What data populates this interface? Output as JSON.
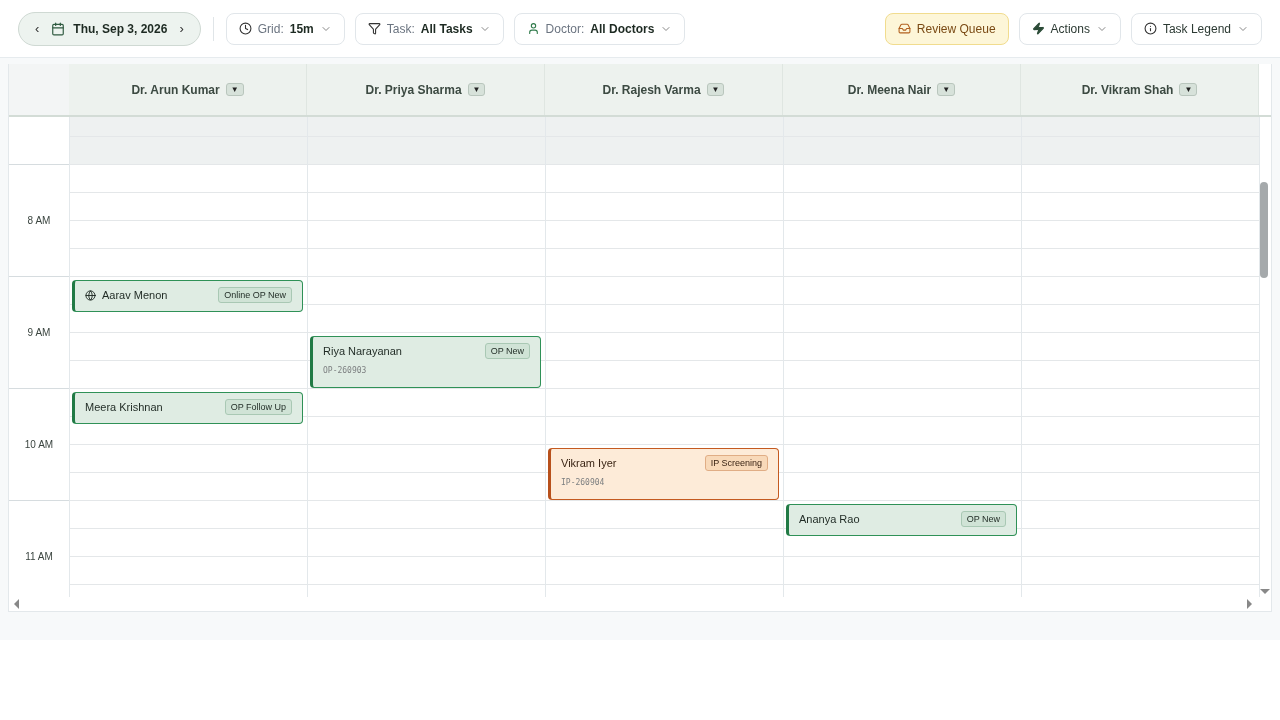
{
  "toolbar": {
    "date_nav": {
      "prev": "‹",
      "date": "Thu, Sep 3, 2026",
      "next": "›"
    },
    "filters": [
      {
        "kind": "grid",
        "label": "Grid:",
        "value": "15m"
      },
      {
        "kind": "task",
        "label": "Task:",
        "value": "All Tasks"
      },
      {
        "kind": "doctor",
        "label": "Doctor:",
        "value": "All Doctors"
      }
    ],
    "review_queue": "Review Queue",
    "actions": "Actions",
    "task_legend": "Task Legend"
  },
  "hours": [
    {
      "off_hours": true
    },
    {
      "label": "8 AM",
      "off_hours": false
    },
    {
      "label": "9 AM",
      "off_hours": false
    },
    {
      "label": "10 AM",
      "off_hours": false
    },
    {
      "label": "11 AM",
      "off_hours": false
    }
  ],
  "doctors": [
    {
      "name": "Dr. Arun Kumar",
      "menu": "▼",
      "slots": [
        {
          "kind": "free"
        },
        {
          "kind": "free"
        },
        {
          "kind": "free"
        },
        {
          "kind": "free"
        },
        {
          "kind": "op",
          "online": true,
          "name": "Aarav Menon",
          "tag": "Online OP New"
        },
        {
          "kind": "free"
        },
        {
          "kind": "free"
        },
        {
          "kind": "free"
        },
        {
          "kind": "op",
          "online": false,
          "name": "Meera Krishnan",
          "tag": "OP Follow Up"
        },
        {
          "kind": "free"
        },
        {
          "kind": "free"
        },
        {
          "kind": "free"
        },
        {
          "kind": "free"
        },
        {
          "kind": "free"
        },
        {
          "kind": "free"
        },
        {
          "kind": "free"
        }
      ]
    },
    {
      "name": "Dr. Priya Sharma",
      "menu": "▼",
      "slots": [
        {
          "kind": "free"
        },
        {
          "kind": "free"
        },
        {
          "kind": "free"
        },
        {
          "kind": "free"
        },
        {
          "kind": "free"
        },
        {
          "kind": "free"
        },
        {
          "kind": "op",
          "online": false,
          "name": "Riya Narayanan",
          "tag": "OP New",
          "mrn": "OP-260903"
        },
        {
          "kind": "cont"
        },
        {
          "kind": "free"
        },
        {
          "kind": "free"
        },
        {
          "kind": "free"
        },
        {
          "kind": "free"
        },
        {
          "kind": "free"
        },
        {
          "kind": "free"
        },
        {
          "kind": "free"
        },
        {
          "kind": "free"
        }
      ]
    },
    {
      "name": "Dr. Rajesh Varma",
      "menu": "▼",
      "slots": [
        {
          "kind": "free"
        },
        {
          "kind": "free"
        },
        {
          "kind": "free"
        },
        {
          "kind": "free"
        },
        {
          "kind": "free"
        },
        {
          "kind": "free"
        },
        {
          "kind": "free"
        },
        {
          "kind": "free"
        },
        {
          "kind": "free"
        },
        {
          "kind": "free"
        },
        {
          "kind": "ip",
          "online": false,
          "name": "Vikram Iyer",
          "tag": "IP Screening",
          "mrn": "IP-260904"
        },
        {
          "kind": "cont"
        },
        {
          "kind": "free"
        },
        {
          "kind": "free"
        },
        {
          "kind": "free"
        },
        {
          "kind": "free"
        }
      ]
    },
    {
      "name": "Dr. Meena Nair",
      "menu": "▼",
      "slots": [
        {
          "kind": "free"
        },
        {
          "kind": "free"
        },
        {
          "kind": "free"
        },
        {
          "kind": "free"
        },
        {
          "kind": "free"
        },
        {
          "kind": "free"
        },
        {
          "kind": "free"
        },
        {
          "kind": "free"
        },
        {
          "kind": "free"
        },
        {
          "kind": "free"
        },
        {
          "kind": "free"
        },
        {
          "kind": "free"
        },
        {
          "kind": "op",
          "online": false,
          "name": "Ananya Rao",
          "tag": "OP New"
        },
        {
          "kind": "free"
        },
        {
          "kind": "free"
        },
        {
          "kind": "free"
        }
      ]
    },
    {
      "name": "Dr. Vikram Shah",
      "menu": "▼",
      "slots": [
        {
          "kind": "free"
        },
        {
          "kind": "free"
        },
        {
          "kind": "free"
        },
        {
          "kind": "free"
        },
        {
          "kind": "free"
        },
        {
          "kind": "free"
        },
        {
          "kind": "free"
        },
        {
          "kind": "free"
        },
        {
          "kind": "free"
        },
        {
          "kind": "free"
        },
        {
          "kind": "free"
        },
        {
          "kind": "free"
        },
        {
          "kind": "free"
        },
        {
          "kind": "free"
        },
        {
          "kind": "free"
        },
        {
          "kind": "free"
        }
      ]
    }
  ]
}
